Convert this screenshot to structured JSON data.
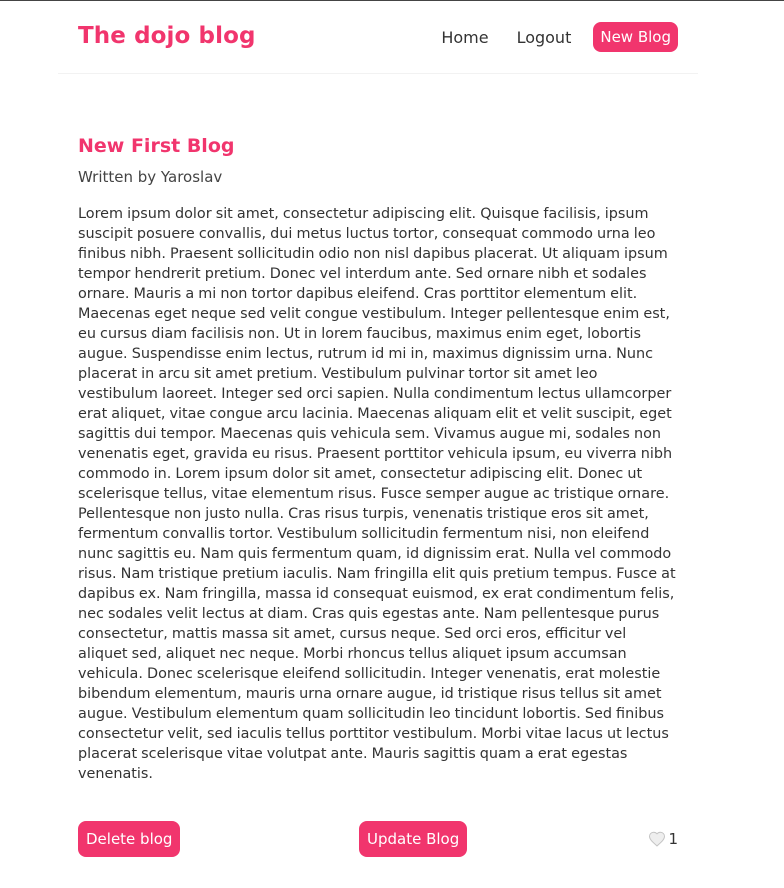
{
  "nav": {
    "brand": "The dojo blog",
    "links": [
      {
        "label": "Home"
      },
      {
        "label": "Logout"
      },
      {
        "label": "New Blog"
      }
    ]
  },
  "blog": {
    "title": "New First Blog",
    "author_line": "Written by Yaroslav",
    "body": "Lorem ipsum dolor sit amet, consectetur adipiscing elit. Quisque facilisis, ipsum suscipit posuere convallis, dui metus luctus tortor, consequat commodo urna leo finibus nibh. Praesent sollicitudin odio non nisl dapibus placerat. Ut aliquam ipsum tempor hendrerit pretium. Donec vel interdum ante. Sed ornare nibh et sodales ornare. Mauris a mi non tortor dapibus eleifend. Cras porttitor elementum elit. Maecenas eget neque sed velit congue vestibulum. Integer pellentesque enim est, eu cursus diam facilisis non. Ut in lorem faucibus, maximus enim eget, lobortis augue. Suspendisse enim lectus, rutrum id mi in, maximus dignissim urna. Nunc placerat in arcu sit amet pretium. Vestibulum pulvinar tortor sit amet leo vestibulum laoreet. Integer sed orci sapien. Nulla condimentum lectus ullamcorper erat aliquet, vitae congue arcu lacinia. Maecenas aliquam elit et velit suscipit, eget sagittis dui tempor. Maecenas quis vehicula sem. Vivamus augue mi, sodales non venenatis eget, gravida eu risus. Praesent porttitor vehicula ipsum, eu viverra nibh commodo in. Lorem ipsum dolor sit amet, consectetur adipiscing elit. Donec ut scelerisque tellus, vitae elementum risus. Fusce semper augue ac tristique ornare. Pellentesque non justo nulla. Cras risus turpis, venenatis tristique eros sit amet, fermentum convallis tortor. Vestibulum sollicitudin fermentum nisi, non eleifend nunc sagittis eu. Nam quis fermentum quam, id dignissim erat. Nulla vel commodo risus. Nam tristique pretium iaculis. Nam fringilla elit quis pretium tempus. Fusce at dapibus ex. Nam fringilla, massa id consequat euismod, ex erat condimentum felis, nec sodales velit lectus at diam. Cras quis egestas ante. Nam pellentesque purus consectetur, mattis massa sit amet, cursus neque. Sed orci eros, efficitur vel aliquet sed, aliquet nec neque. Morbi rhoncus tellus aliquet ipsum accumsan vehicula. Donec scelerisque eleifend sollicitudin. Integer venenatis, erat molestie bibendum elementum, mauris urna ornare augue, id tristique risus tellus sit amet augue. Vestibulum elementum quam sollicitudin leo tincidunt lobortis. Sed finibus consectetur velit, sed iaculis tellus porttitor vestibulum. Morbi vitae lacus ut lectus placerat scelerisque vitae volutpat ante. Mauris sagittis quam a erat egestas venenatis."
  },
  "actions": {
    "delete_label": "Delete blog",
    "update_label": "Update Blog"
  },
  "likes": {
    "icon": "heart-icon",
    "count": "1"
  },
  "colors": {
    "accent": "#f1356d",
    "text": "#333333"
  }
}
